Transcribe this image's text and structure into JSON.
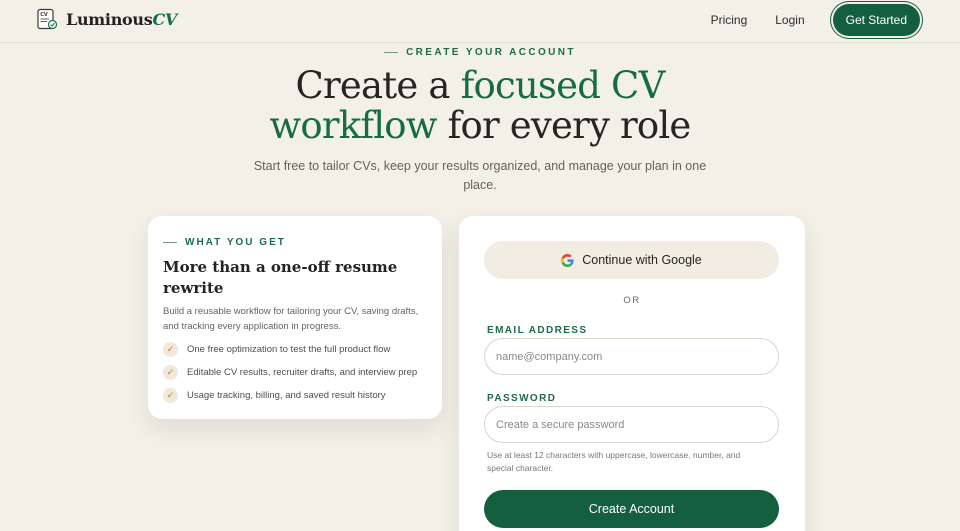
{
  "header": {
    "brand": {
      "name_main": "Luminous",
      "name_accent": "CV",
      "logo_icon": "cv-document-icon"
    },
    "nav": {
      "pricing": "Pricing",
      "login": "Login",
      "cta": "Get Started"
    }
  },
  "hero": {
    "eyebrow": "CREATE YOUR ACCOUNT",
    "title_line1_a": "Create a ",
    "title_line1_b": "focused CV",
    "title_line2_a": "workflow",
    "title_line2_b": " for every role",
    "subtitle_line1": "Start free to tailor CVs, keep your results organized, and manage your plan in one",
    "subtitle_line2": "place."
  },
  "benefits": {
    "eyebrow": "WHAT YOU GET",
    "title_line1": "More than a one-off resume",
    "title_line2": "rewrite",
    "desc_line1": "Build a reusable workflow for tailoring your CV, saving drafts,",
    "desc_line2": "and tracking every application in progress.",
    "items": [
      {
        "label": "One free optimization to test the full product flow",
        "icon": "check-icon"
      },
      {
        "label": "Editable CV results, recruiter drafts, and interview prep",
        "icon": "check-icon"
      },
      {
        "label": "Usage tracking, billing, and saved result history",
        "icon": "check-icon"
      }
    ]
  },
  "signup": {
    "google_label": "Continue with Google",
    "google_icon": "google-icon",
    "divider": "OR",
    "email": {
      "label": "EMAIL ADDRESS",
      "placeholder": "name@company.com",
      "value": ""
    },
    "password": {
      "label": "PASSWORD",
      "placeholder": "Create a secure password",
      "value": ""
    },
    "hint_line1": "Use at least 12 characters with uppercase, lowercase, number, and",
    "hint_line2": "special character.",
    "submit": "Create Account"
  },
  "colors": {
    "accent": "#156c48",
    "background": "#f3f0e8",
    "button": "#135f40",
    "check": "#c07a3c"
  }
}
